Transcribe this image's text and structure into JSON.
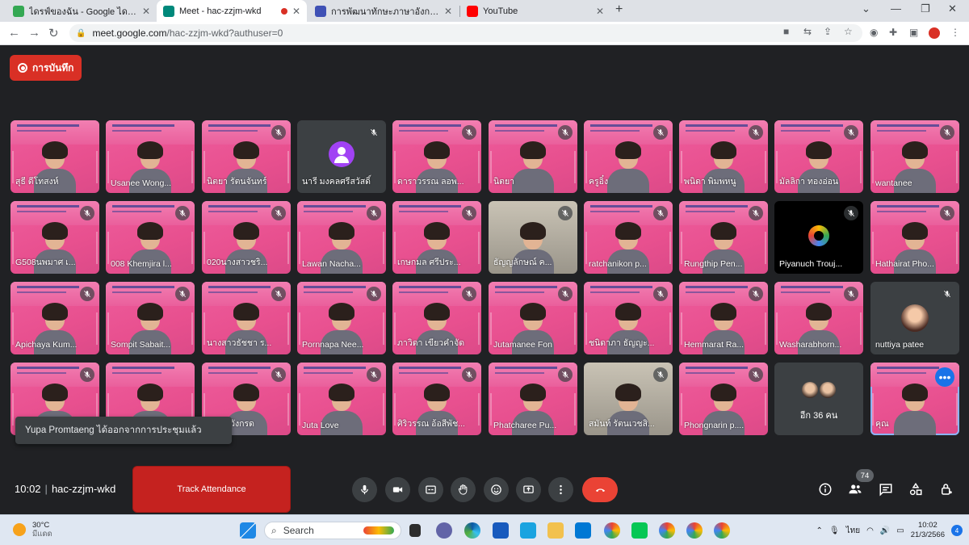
{
  "browser": {
    "tabs": [
      {
        "label": "ไดรฟ์ของฉัน - Google ไดรฟ์",
        "favicon": "google-drive-icon",
        "color": "#34a853"
      },
      {
        "label": "Meet - hac-zzjm-wkd",
        "favicon": "google-meet-icon",
        "color": "#00897b",
        "active": true
      },
      {
        "label": "การพัฒนาทักษะภาษาอังกฤษ English",
        "favicon": "google-forms-icon",
        "color": "#3f51b5"
      },
      {
        "label": "YouTube",
        "favicon": "youtube-icon",
        "color": "#ff0000"
      }
    ],
    "url_host": "meet.google.com",
    "url_path": "/hac-zzjm-wkd?authuser=0"
  },
  "meet": {
    "recording_label": "การบันทึก",
    "tiles": [
      {
        "name": "สุธี ดีโทสงห์",
        "kind": "slide",
        "muted": false
      },
      {
        "name": "Usanee Wong...",
        "kind": "slide",
        "muted": false
      },
      {
        "name": "นิตยา รัตนจันทร์",
        "kind": "slide",
        "muted": true
      },
      {
        "name": "นารี มงคลศรีสวัสดิ์",
        "kind": "avatar",
        "muted": true
      },
      {
        "name": "ดาราวรรณ ลอพ...",
        "kind": "slide",
        "muted": true
      },
      {
        "name": "นิตยา",
        "kind": "slide",
        "muted": true
      },
      {
        "name": "ครูอิ๋ง",
        "kind": "slide",
        "muted": true
      },
      {
        "name": "พนิดา พิมพหนู",
        "kind": "slide",
        "muted": true
      },
      {
        "name": "มัลลิกา ทองอ่อน",
        "kind": "slide",
        "muted": true
      },
      {
        "name": "wantanee",
        "kind": "slide",
        "muted": true
      },
      {
        "name": "G508นพมาศ เ...",
        "kind": "slide",
        "muted": true
      },
      {
        "name": "008 Khemjira l...",
        "kind": "slide",
        "muted": true
      },
      {
        "name": "020นางสาวชริ...",
        "kind": "slide",
        "muted": true
      },
      {
        "name": "Lawan Nacha...",
        "kind": "slide",
        "muted": true
      },
      {
        "name": "เกษกมล ศรีประ...",
        "kind": "slide",
        "muted": true
      },
      {
        "name": "ธัญญลักษณ์ ค...",
        "kind": "photo",
        "muted": true
      },
      {
        "name": "ratchanikon p...",
        "kind": "slide",
        "muted": true
      },
      {
        "name": "Rungthip Pen...",
        "kind": "slide",
        "muted": true
      },
      {
        "name": "Piyanuch Trouj...",
        "kind": "camlogo",
        "muted": true
      },
      {
        "name": "Hathairat Pho...",
        "kind": "slide",
        "muted": true
      },
      {
        "name": "Apichaya Kum...",
        "kind": "slide",
        "muted": true
      },
      {
        "name": "Sompit Sabait...",
        "kind": "slide",
        "muted": true
      },
      {
        "name": "นางสาวธัชชา ร...",
        "kind": "slide",
        "muted": true
      },
      {
        "name": "Pornnapa Nee...",
        "kind": "slide",
        "muted": true
      },
      {
        "name": "ภาวิดา เขียวคำจัด",
        "kind": "slide",
        "muted": true
      },
      {
        "name": "Jutamanee Fon",
        "kind": "slide",
        "muted": true
      },
      {
        "name": "ชนิดาภา ธัญญะ...",
        "kind": "slide",
        "muted": true
      },
      {
        "name": "Hemmarat Ra...",
        "kind": "slide",
        "muted": true
      },
      {
        "name": "Washarabhorn...",
        "kind": "slide",
        "muted": true
      },
      {
        "name": "nuttiya patee",
        "kind": "avatar-photo",
        "muted": true
      },
      {
        "name": "",
        "kind": "slide",
        "muted": true
      },
      {
        "name": "",
        "kind": "slide",
        "muted": false
      },
      {
        "name": "วา ขุนวังกรด",
        "kind": "slide",
        "muted": true
      },
      {
        "name": "Juta Love",
        "kind": "slide",
        "muted": true
      },
      {
        "name": "ศิริวรรณ อ้อสีพัช...",
        "kind": "slide",
        "muted": true
      },
      {
        "name": "Phatcharee Pu...",
        "kind": "slide",
        "muted": true
      },
      {
        "name": "สมันท์ รัตนเวชสิ...",
        "kind": "photo",
        "muted": true
      },
      {
        "name": "Phongnarin p....",
        "kind": "slide",
        "muted": true
      },
      {
        "name": "อีก 36 คน",
        "kind": "others",
        "muted": false
      },
      {
        "name": "คุณ",
        "kind": "self",
        "muted": false
      }
    ],
    "toast": "Yupa Promtaeng ได้ออกจากการประชุมแล้ว",
    "track_attendance": "Track Attendance",
    "time": "10:02",
    "meeting_code": "hac-zzjm-wkd",
    "people_count": "74",
    "accent_red": "#ea4335",
    "accent_blue": "#1a73e8"
  },
  "taskbar": {
    "temperature": "30°C",
    "weather": "มีแดด",
    "search_label": "Search",
    "language": "ไทย",
    "clock_time": "10:02",
    "clock_date": "21/3/2566",
    "notifications": "4"
  }
}
